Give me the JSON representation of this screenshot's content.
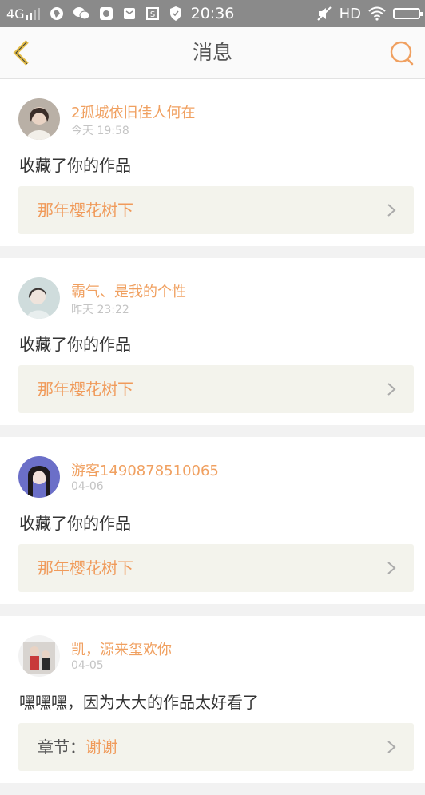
{
  "status_bar": {
    "network": "4G",
    "time": "20:36",
    "hd": "HD"
  },
  "header": {
    "title": "消息"
  },
  "colors": {
    "accent": "#f0a060",
    "link_text": "#f09a5a",
    "back_arrow": "#e8c04a",
    "status_bar_bg": "#8a8a8a",
    "card_link_bg": "#f3f3ec"
  },
  "messages": [
    {
      "user": "2孤城依旧佳人何在",
      "time": "今天 19:58",
      "content": "收藏了你的作品",
      "work_prefix": "",
      "work_title": "那年樱花树下"
    },
    {
      "user": "霸气、是我的个性",
      "time": "昨天 23:22",
      "content": "收藏了你的作品",
      "work_prefix": "",
      "work_title": "那年樱花树下"
    },
    {
      "user": "游客1490878510065",
      "time": "04-06",
      "content": "收藏了你的作品",
      "work_prefix": "",
      "work_title": "那年樱花树下"
    },
    {
      "user": "凯，源来玺欢你",
      "time": "04-05",
      "content": "嘿嘿嘿，因为大大的作品太好看了",
      "work_prefix": "章节：",
      "work_title": "谢谢"
    }
  ]
}
